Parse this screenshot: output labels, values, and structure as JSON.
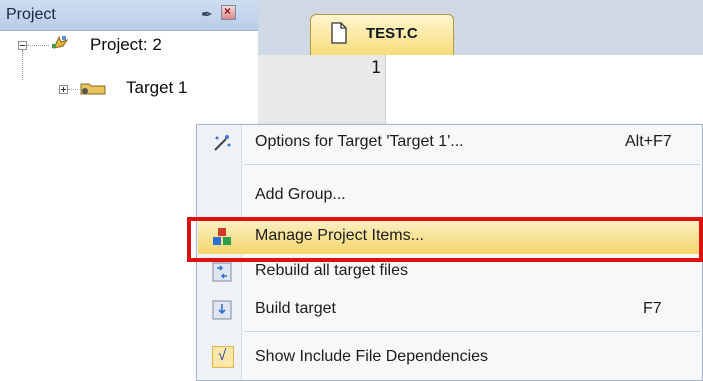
{
  "project_panel": {
    "title": "Project",
    "pin_glyph": "✒",
    "close_glyph": "×",
    "tree": {
      "root_label": "Project: 2",
      "target_label": "Target 1"
    }
  },
  "editor": {
    "tab_label": "TEST.C",
    "line_number": "1"
  },
  "context_menu": {
    "items": [
      {
        "label": "Options for Target 'Target 1'...",
        "shortcut": "Alt+F7",
        "icon": "options-wand-icon"
      },
      {
        "label": "Add Group...",
        "shortcut": "",
        "icon": ""
      },
      {
        "label": "Manage Project Items...",
        "shortcut": "",
        "icon": "manage-items-icon",
        "highlighted": true
      },
      {
        "label": "Rebuild all target files",
        "shortcut": "",
        "icon": "rebuild-icon"
      },
      {
        "label": "Build target",
        "shortcut": "F7",
        "icon": "build-icon"
      },
      {
        "label": "Show Include File Dependencies",
        "shortcut": "",
        "icon": "check-icon",
        "checked": true,
        "check_glyph": "√"
      }
    ]
  },
  "colors": {
    "highlight_border": "#e01010",
    "selected_item_bg": "#f4d66a",
    "panel_header": "#b9cde8"
  }
}
